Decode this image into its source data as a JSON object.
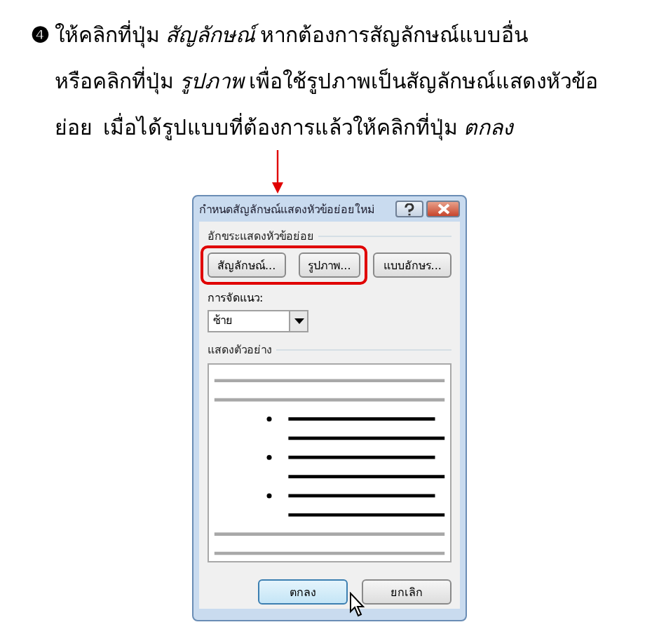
{
  "instruction": {
    "step": "❹",
    "text": "ให้คลิกที่ปุ่ม *สัญลักษณ์* หากต้องการสัญลักษณ์แบบอื่น\nหรือคลิกที่ปุ่ม *รูปภาพ* เพื่อใช้รูปภาพเป็นสัญลักษณ์แสดงหัวข้อ\nย่อย  เมื่อได้รูปแบบที่ต้องการแล้วให้คลิกที่ปุ่ม *ตกลง*"
  },
  "dialog": {
    "title": "กำหนดสัญลักษณ์แสดงหัวข้อย่อยใหม่",
    "bullet_group": {
      "label": "อักขระแสดงหัวข้อย่อย",
      "buttons": [
        {
          "label": "สัญลักษณ์...",
          "highlighted": true
        },
        {
          "label": "รูปภาพ...",
          "highlighted": true
        },
        {
          "label": "แบบอักษร...",
          "highlighted": false
        }
      ]
    },
    "alignment": {
      "label": "การจัดแนว:",
      "value": "ซ้าย"
    },
    "preview": {
      "label": "แสดงตัวอย่าง"
    },
    "buttons": [
      {
        "label": "ตกลง",
        "default": true
      },
      {
        "label": "ยกเลิก",
        "default": false
      }
    ]
  }
}
